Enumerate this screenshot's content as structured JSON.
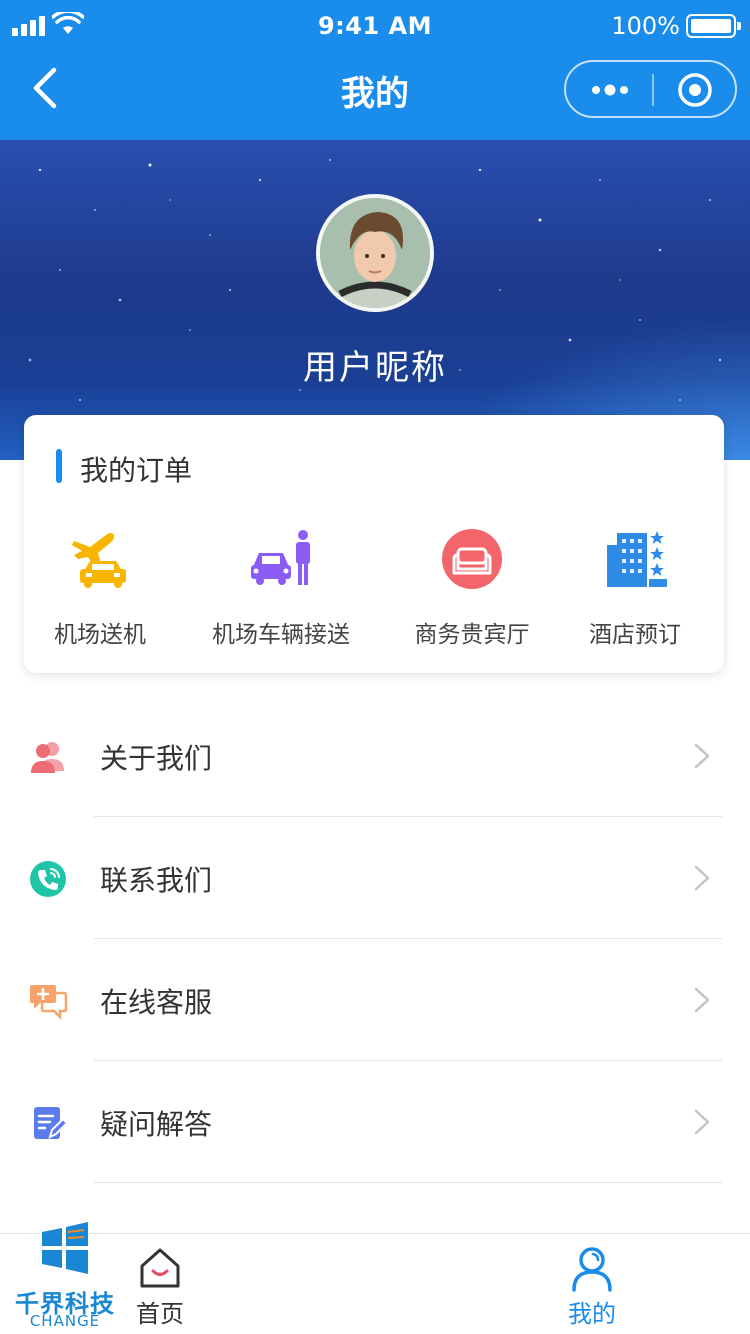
{
  "status_bar": {
    "time": "9:41 AM",
    "battery": "100%"
  },
  "nav": {
    "title": "我的"
  },
  "profile": {
    "nickname": "用户昵称"
  },
  "orders": {
    "title": "我的订单",
    "items": [
      {
        "label": "机场送机",
        "icon": "airport-dropoff-icon"
      },
      {
        "label": "机场车辆接送",
        "icon": "car-pickup-icon"
      },
      {
        "label": "商务贵宾厅",
        "icon": "vip-lounge-icon"
      },
      {
        "label": "酒店预订",
        "icon": "hotel-icon"
      }
    ]
  },
  "menu": {
    "items": [
      {
        "label": "关于我们",
        "icon": "users-icon"
      },
      {
        "label": "联系我们",
        "icon": "phone-icon"
      },
      {
        "label": "在线客服",
        "icon": "chat-icon"
      },
      {
        "label": "疑问解答",
        "icon": "faq-icon"
      }
    ]
  },
  "tabbar": {
    "tabs": [
      {
        "label": "首页",
        "icon": "home-icon"
      },
      {
        "label": "我的",
        "icon": "profile-icon",
        "active": true
      }
    ]
  },
  "watermark": {
    "line1": "千界科技",
    "line2": "CHANGE"
  },
  "colors": {
    "primary": "#1A8CEB",
    "active_tab": "#1A8CEB"
  }
}
